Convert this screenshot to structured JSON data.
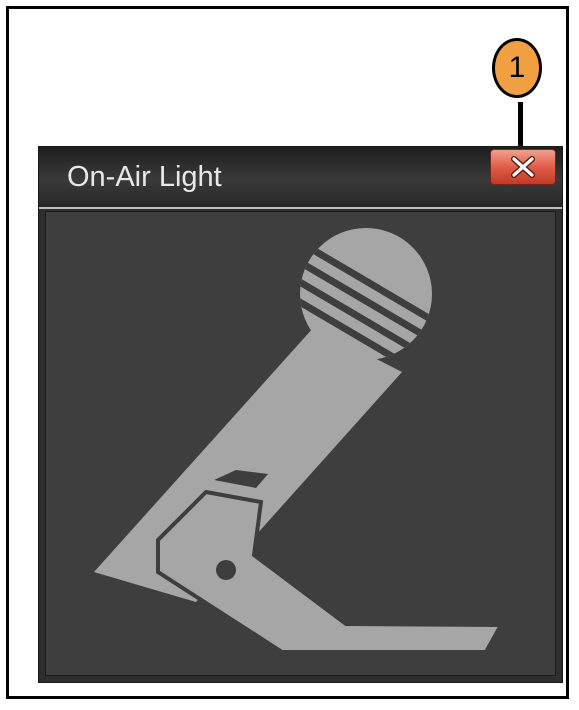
{
  "callout": {
    "number": "1",
    "color": "#f0a040"
  },
  "window": {
    "title": "On-Air Light",
    "close_icon": "close-icon",
    "close_color": "#e05c48"
  },
  "content": {
    "icon": "microphone-icon",
    "icon_color": "#a6a6a6",
    "background": "#3e3e3e"
  }
}
